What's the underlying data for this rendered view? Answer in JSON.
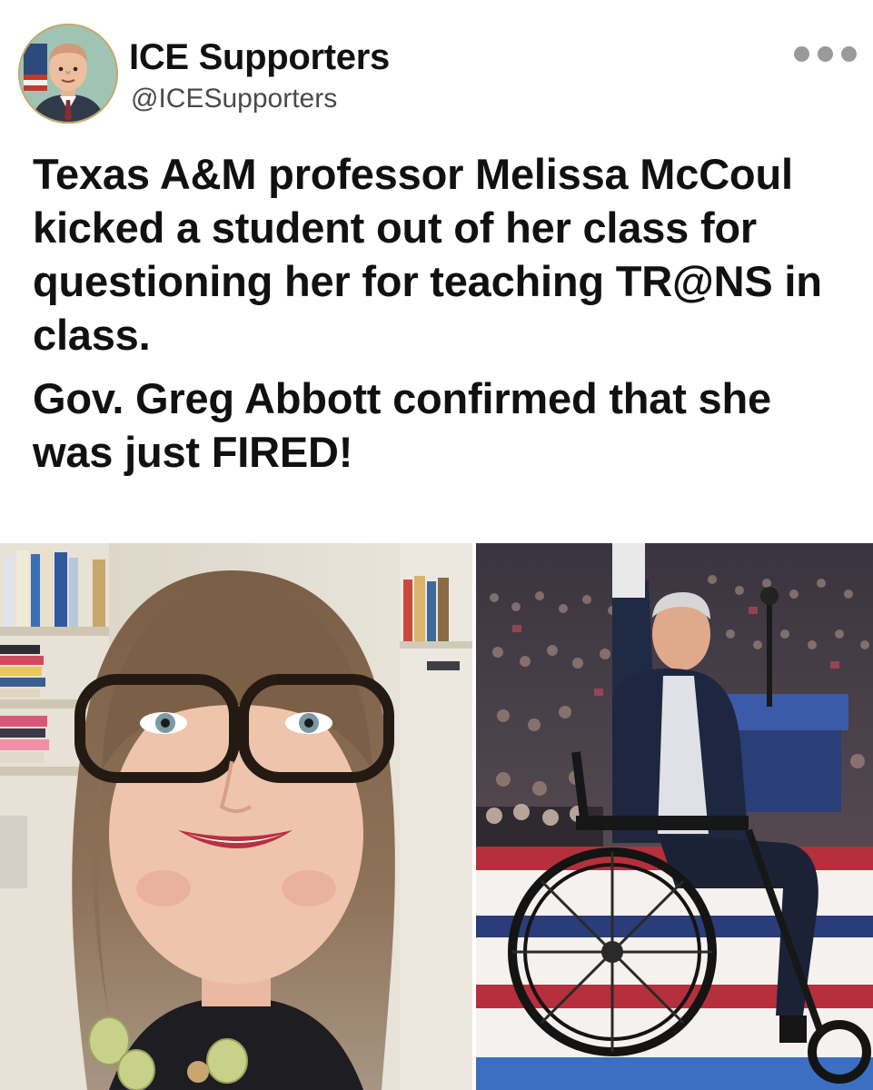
{
  "post": {
    "author_name": "ICE Supporters",
    "author_handle": "@ICESupporters",
    "paragraphs": [
      "Texas A&M professor Melissa McCoul kicked a student out of her class for questioning her for teaching TR@NS in class.",
      "Gov. Greg Abbott confirmed that she was just FIRED!"
    ]
  },
  "icons": {
    "more": "more-horizontal-icon",
    "avatar": "cartoon-portrait-avatar"
  },
  "colors": {
    "text": "#111111",
    "handle": "#4a4a4a",
    "dots": "#9a9a9a",
    "background": "#ffffff"
  }
}
